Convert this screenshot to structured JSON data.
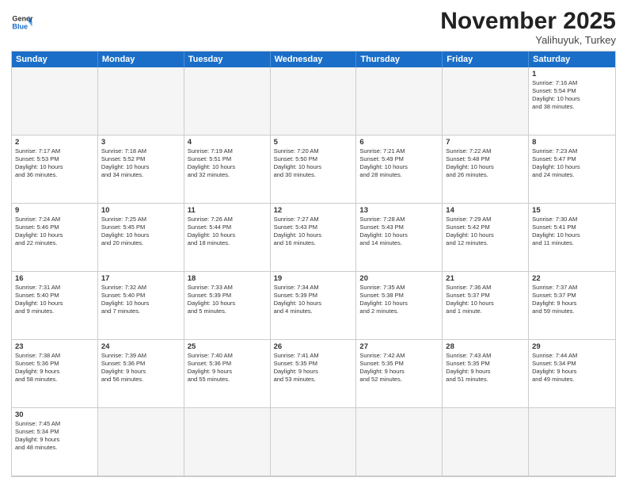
{
  "header": {
    "logo_general": "General",
    "logo_blue": "Blue",
    "month_title": "November 2025",
    "location": "Yalihuyuk, Turkey"
  },
  "day_headers": [
    "Sunday",
    "Monday",
    "Tuesday",
    "Wednesday",
    "Thursday",
    "Friday",
    "Saturday"
  ],
  "cells": [
    {
      "day": "",
      "info": "",
      "empty": true
    },
    {
      "day": "",
      "info": "",
      "empty": true
    },
    {
      "day": "",
      "info": "",
      "empty": true
    },
    {
      "day": "",
      "info": "",
      "empty": true
    },
    {
      "day": "",
      "info": "",
      "empty": true
    },
    {
      "day": "",
      "info": "",
      "empty": true
    },
    {
      "day": "1",
      "info": "Sunrise: 7:16 AM\nSunset: 5:54 PM\nDaylight: 10 hours\nand 38 minutes."
    },
    {
      "day": "2",
      "info": "Sunrise: 7:17 AM\nSunset: 5:53 PM\nDaylight: 10 hours\nand 36 minutes."
    },
    {
      "day": "3",
      "info": "Sunrise: 7:18 AM\nSunset: 5:52 PM\nDaylight: 10 hours\nand 34 minutes."
    },
    {
      "day": "4",
      "info": "Sunrise: 7:19 AM\nSunset: 5:51 PM\nDaylight: 10 hours\nand 32 minutes."
    },
    {
      "day": "5",
      "info": "Sunrise: 7:20 AM\nSunset: 5:50 PM\nDaylight: 10 hours\nand 30 minutes."
    },
    {
      "day": "6",
      "info": "Sunrise: 7:21 AM\nSunset: 5:49 PM\nDaylight: 10 hours\nand 28 minutes."
    },
    {
      "day": "7",
      "info": "Sunrise: 7:22 AM\nSunset: 5:48 PM\nDaylight: 10 hours\nand 26 minutes."
    },
    {
      "day": "8",
      "info": "Sunrise: 7:23 AM\nSunset: 5:47 PM\nDaylight: 10 hours\nand 24 minutes."
    },
    {
      "day": "9",
      "info": "Sunrise: 7:24 AM\nSunset: 5:46 PM\nDaylight: 10 hours\nand 22 minutes."
    },
    {
      "day": "10",
      "info": "Sunrise: 7:25 AM\nSunset: 5:45 PM\nDaylight: 10 hours\nand 20 minutes."
    },
    {
      "day": "11",
      "info": "Sunrise: 7:26 AM\nSunset: 5:44 PM\nDaylight: 10 hours\nand 18 minutes."
    },
    {
      "day": "12",
      "info": "Sunrise: 7:27 AM\nSunset: 5:43 PM\nDaylight: 10 hours\nand 16 minutes."
    },
    {
      "day": "13",
      "info": "Sunrise: 7:28 AM\nSunset: 5:43 PM\nDaylight: 10 hours\nand 14 minutes."
    },
    {
      "day": "14",
      "info": "Sunrise: 7:29 AM\nSunset: 5:42 PM\nDaylight: 10 hours\nand 12 minutes."
    },
    {
      "day": "15",
      "info": "Sunrise: 7:30 AM\nSunset: 5:41 PM\nDaylight: 10 hours\nand 11 minutes."
    },
    {
      "day": "16",
      "info": "Sunrise: 7:31 AM\nSunset: 5:40 PM\nDaylight: 10 hours\nand 9 minutes."
    },
    {
      "day": "17",
      "info": "Sunrise: 7:32 AM\nSunset: 5:40 PM\nDaylight: 10 hours\nand 7 minutes."
    },
    {
      "day": "18",
      "info": "Sunrise: 7:33 AM\nSunset: 5:39 PM\nDaylight: 10 hours\nand 5 minutes."
    },
    {
      "day": "19",
      "info": "Sunrise: 7:34 AM\nSunset: 5:39 PM\nDaylight: 10 hours\nand 4 minutes."
    },
    {
      "day": "20",
      "info": "Sunrise: 7:35 AM\nSunset: 5:38 PM\nDaylight: 10 hours\nand 2 minutes."
    },
    {
      "day": "21",
      "info": "Sunrise: 7:36 AM\nSunset: 5:37 PM\nDaylight: 10 hours\nand 1 minute."
    },
    {
      "day": "22",
      "info": "Sunrise: 7:37 AM\nSunset: 5:37 PM\nDaylight: 9 hours\nand 59 minutes."
    },
    {
      "day": "23",
      "info": "Sunrise: 7:38 AM\nSunset: 5:36 PM\nDaylight: 9 hours\nand 58 minutes."
    },
    {
      "day": "24",
      "info": "Sunrise: 7:39 AM\nSunset: 5:36 PM\nDaylight: 9 hours\nand 56 minutes."
    },
    {
      "day": "25",
      "info": "Sunrise: 7:40 AM\nSunset: 5:36 PM\nDaylight: 9 hours\nand 55 minutes."
    },
    {
      "day": "26",
      "info": "Sunrise: 7:41 AM\nSunset: 5:35 PM\nDaylight: 9 hours\nand 53 minutes."
    },
    {
      "day": "27",
      "info": "Sunrise: 7:42 AM\nSunset: 5:35 PM\nDaylight: 9 hours\nand 52 minutes."
    },
    {
      "day": "28",
      "info": "Sunrise: 7:43 AM\nSunset: 5:35 PM\nDaylight: 9 hours\nand 51 minutes."
    },
    {
      "day": "29",
      "info": "Sunrise: 7:44 AM\nSunset: 5:34 PM\nDaylight: 9 hours\nand 49 minutes."
    },
    {
      "day": "30",
      "info": "Sunrise: 7:45 AM\nSunset: 5:34 PM\nDaylight: 9 hours\nand 48 minutes."
    },
    {
      "day": "",
      "info": "",
      "empty": true
    },
    {
      "day": "",
      "info": "",
      "empty": true
    },
    {
      "day": "",
      "info": "",
      "empty": true
    },
    {
      "day": "",
      "info": "",
      "empty": true
    },
    {
      "day": "",
      "info": "",
      "empty": true
    },
    {
      "day": "",
      "info": "",
      "empty": true
    }
  ]
}
